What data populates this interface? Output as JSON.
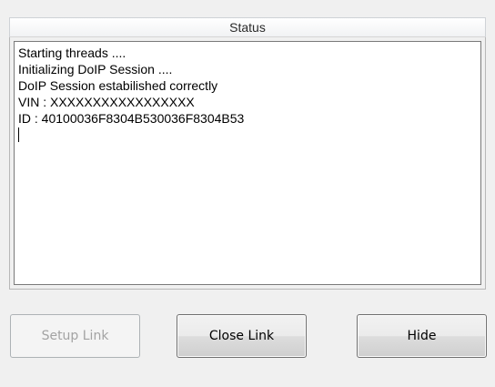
{
  "status": {
    "header": "Status",
    "lines": [
      "Starting threads ....",
      "Initializing DoIP Session ....",
      "DoIP Session estabilished correctly",
      "VIN : XXXXXXXXXXXXXXXXX",
      "ID : 40100036F8304B530036F8304B53"
    ]
  },
  "buttons": {
    "setup_link": "Setup Link",
    "close_link": "Close Link",
    "hide": "Hide"
  }
}
